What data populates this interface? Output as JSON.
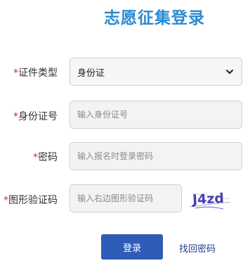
{
  "title": "志愿征集登录",
  "form": {
    "id_type": {
      "required_mark": "*",
      "label": "证件类型",
      "value": "身份证"
    },
    "id_number": {
      "required_mark": "*",
      "label": "身份证号",
      "placeholder": "输入身份证号"
    },
    "password": {
      "required_mark": "*",
      "label": "密码",
      "placeholder": "输入报名时登录密码"
    },
    "captcha": {
      "required_mark": "*",
      "label": "图形验证码",
      "placeholder": "输入右边图形验证码",
      "image_text": "J4zd"
    }
  },
  "actions": {
    "login_label": "登录",
    "forgot_label": "找回密码"
  },
  "colors": {
    "title": "#2a8ad3",
    "required": "#c9302c",
    "button": "#2e5cb8",
    "link": "#1f3f8a",
    "captcha_text": "#4a3fb0"
  }
}
